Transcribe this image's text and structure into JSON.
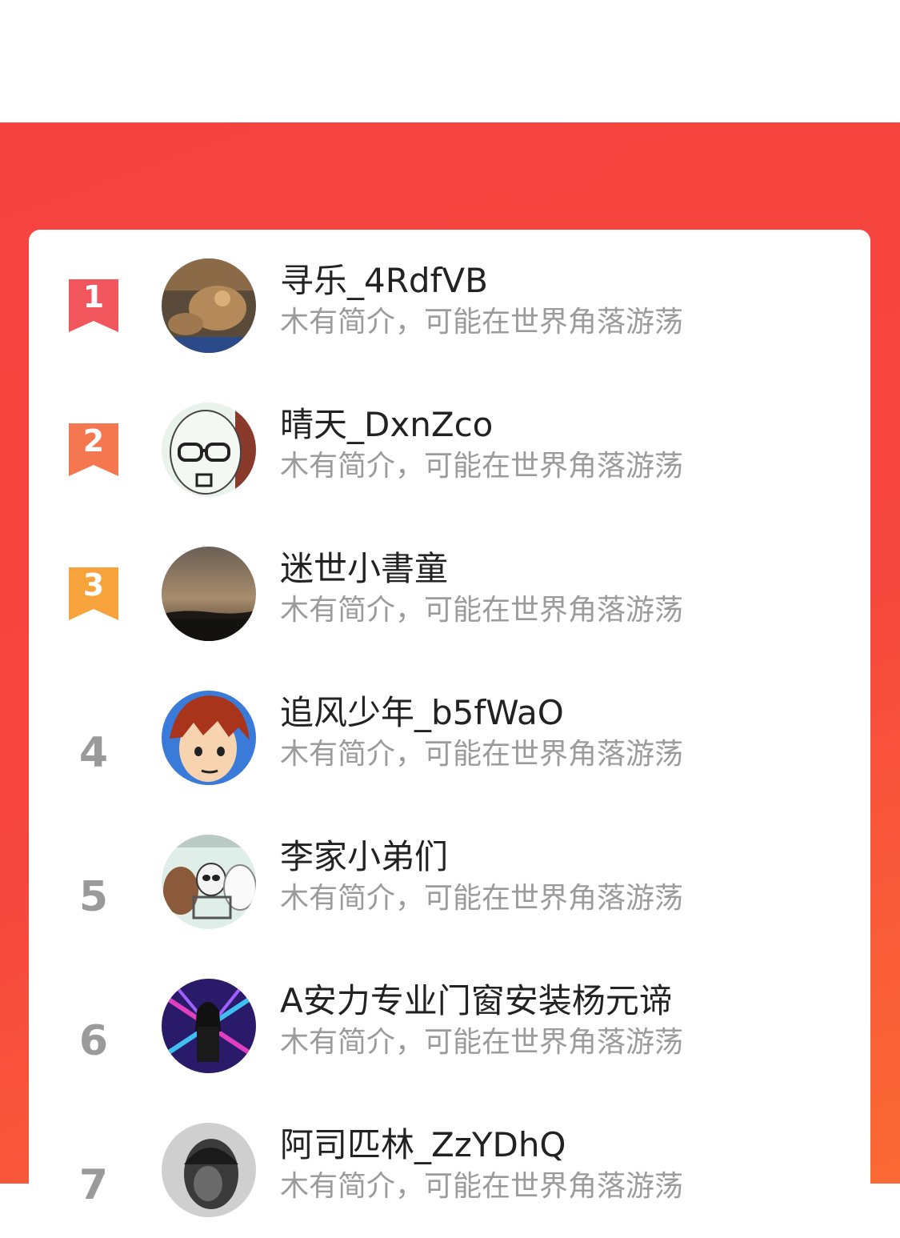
{
  "colors": {
    "banner": "#f5423f",
    "banner_end": "#fb6a35",
    "rank1": "#f1565c",
    "rank2": "#f5774f",
    "rank3": "#f7a23a",
    "rank_gray": "#9a9a9a"
  },
  "ranking": [
    {
      "rank": "1",
      "name": "寻乐_4RdfVB",
      "desc": "木有简介，可能在世界角落游荡",
      "badge": "ribbon-red-icon"
    },
    {
      "rank": "2",
      "name": "晴天_DxnZco",
      "desc": "木有简介，可能在世界角落游荡",
      "badge": "ribbon-orange-icon"
    },
    {
      "rank": "3",
      "name": "迷世小書童",
      "desc": "木有简介，可能在世界角落游荡",
      "badge": "ribbon-yellow-icon"
    },
    {
      "rank": "4",
      "name": "追风少年_b5fWaO",
      "desc": "木有简介，可能在世界角落游荡"
    },
    {
      "rank": "5",
      "name": "李家小弟们",
      "desc": "木有简介，可能在世界角落游荡"
    },
    {
      "rank": "6",
      "name": "A安力专业门窗安装杨元谛",
      "desc": "木有简介，可能在世界角落游荡"
    },
    {
      "rank": "7",
      "name": "阿司匹林_ZzYDhQ",
      "desc": "木有简介，可能在世界角落游荡"
    }
  ]
}
